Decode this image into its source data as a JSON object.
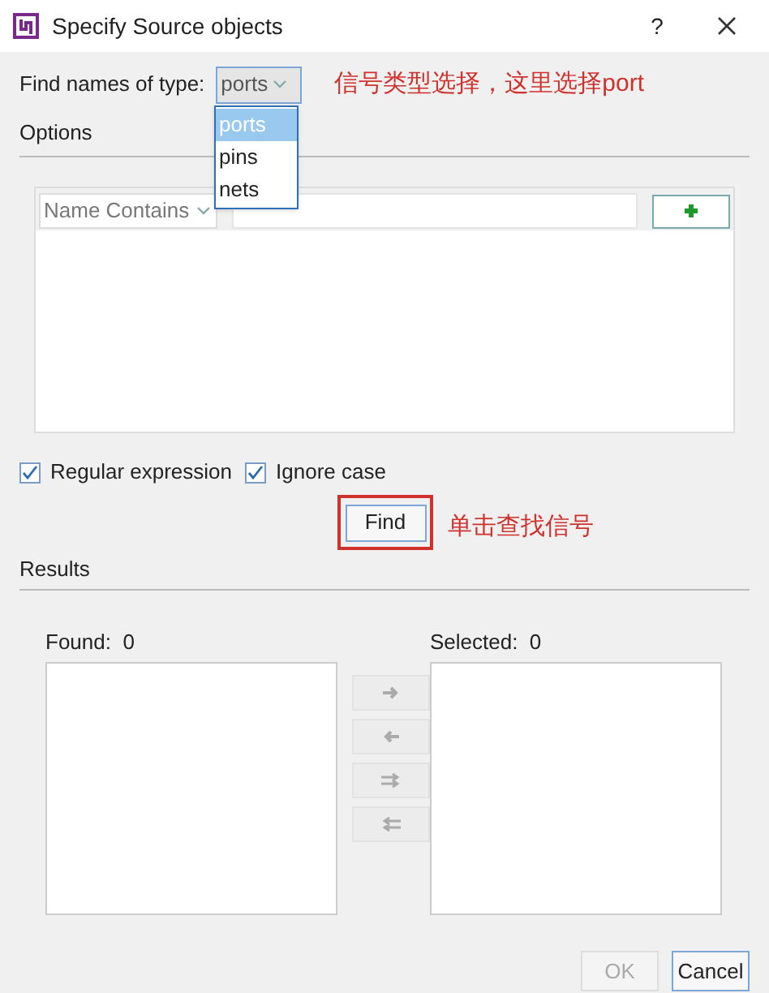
{
  "window": {
    "title": "Specify Source objects",
    "help": "?"
  },
  "find_type": {
    "label": "Find names of type:",
    "value": "ports",
    "expanded": true,
    "options": [
      {
        "label": "ports",
        "selected": true
      },
      {
        "label": "pins",
        "selected": false
      },
      {
        "label": "nets",
        "selected": false
      }
    ]
  },
  "annotations": [
    {
      "text": "信号类型选择，这里选择port"
    },
    {
      "text": "单击查找信号"
    }
  ],
  "options_heading": "Options",
  "filter": {
    "criterion": "Name Contains"
  },
  "checkboxes": [
    {
      "label": "Regular expression",
      "checked": true
    },
    {
      "label": "Ignore case",
      "checked": true
    }
  ],
  "find_button": {
    "label": "Find",
    "highlighted": true
  },
  "results_heading": "Results",
  "found": {
    "label": "Found:",
    "count": "0"
  },
  "selected": {
    "label": "Selected:",
    "count": "0"
  },
  "buttons": [
    {
      "label": "OK",
      "disabled": true
    },
    {
      "label": "Cancel",
      "disabled": false
    }
  ]
}
